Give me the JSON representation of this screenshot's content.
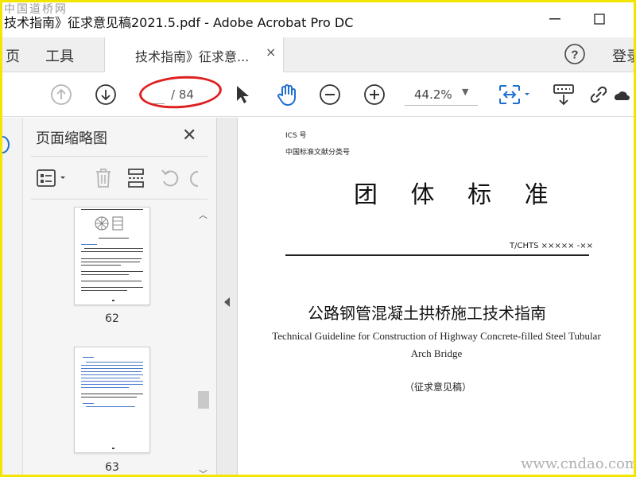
{
  "window": {
    "title": "技术指南》征求意见稿2021.5.pdf - Adobe Acrobat Pro DC",
    "watermark": "中国道桥网"
  },
  "tabs": {
    "home_partial": "页",
    "tools": "工具",
    "document": "技术指南》征求意...",
    "close": "×",
    "login_partial": "登录"
  },
  "toolbar": {
    "page_current": "",
    "page_total": "/ 84",
    "zoom": "44.2%"
  },
  "thumbnails": {
    "title": "页面缩略图",
    "pages": [
      {
        "number": "62"
      },
      {
        "number": "63"
      }
    ]
  },
  "document": {
    "ics": "ICS 号",
    "classification": "中国标准文献分类号",
    "standard_type": "团 体 标 准",
    "code": "T/CHTS ××××× -××",
    "title_cn": "公路钢管混凝土拱桥施工技术指南",
    "title_en": "Technical Guideline for Construction of Highway Concrete-filled Steel Tubular Arch Bridge",
    "draft": "（征求意见稿）"
  },
  "site_watermark": "www.cndao.com",
  "colors": {
    "frame": "#f2e600",
    "annotation": "#e02020",
    "thumb_text_blue": "#4a7bd0"
  }
}
